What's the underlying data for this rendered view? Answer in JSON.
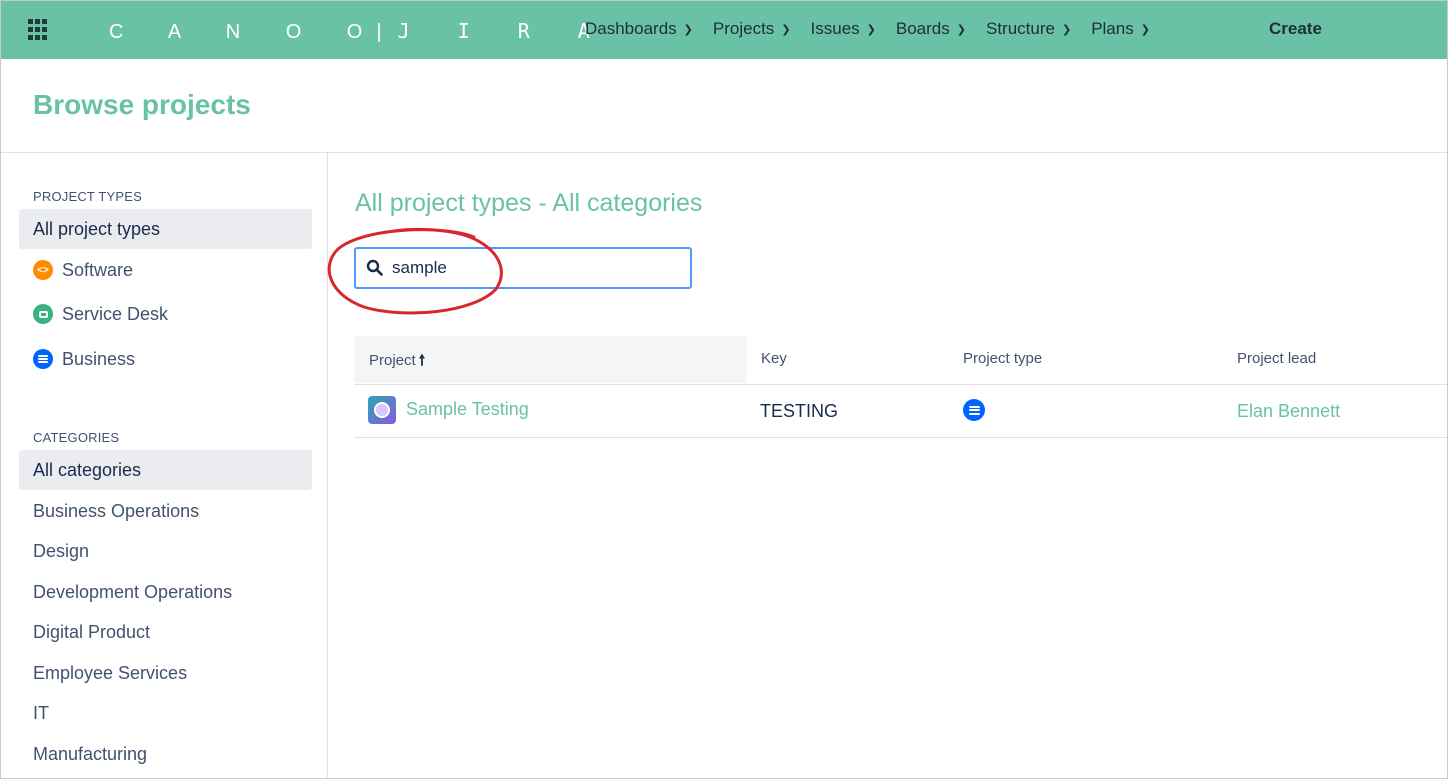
{
  "topnav": {
    "logo_left": "C A N O O",
    "logo_sep": "|",
    "logo_right": "J I R A",
    "menu": [
      {
        "label": "Dashboards"
      },
      {
        "label": "Projects"
      },
      {
        "label": "Issues"
      },
      {
        "label": "Boards"
      },
      {
        "label": "Structure"
      },
      {
        "label": "Plans"
      }
    ],
    "create_label": "Create"
  },
  "header": {
    "title": "Browse projects"
  },
  "sidebar": {
    "project_types_heading": "PROJECT TYPES",
    "project_types": [
      {
        "label": "All project types",
        "selected": true
      },
      {
        "label": "Software",
        "icon": "software-icon"
      },
      {
        "label": "Service Desk",
        "icon": "service-desk-icon"
      },
      {
        "label": "Business",
        "icon": "business-icon"
      }
    ],
    "categories_heading": "CATEGORIES",
    "categories": [
      {
        "label": "All categories",
        "selected": true
      },
      {
        "label": "Business Operations"
      },
      {
        "label": "Design"
      },
      {
        "label": "Development Operations"
      },
      {
        "label": "Digital Product"
      },
      {
        "label": "Employee Services"
      },
      {
        "label": "IT"
      },
      {
        "label": "Manufacturing"
      }
    ]
  },
  "main": {
    "title": "All project types - All categories",
    "search": {
      "value": "sample"
    },
    "table": {
      "headers": {
        "project": "Project",
        "sort_arrow": "🠕",
        "key": "Key",
        "type": "Project type",
        "lead": "Project lead"
      },
      "rows": [
        {
          "project": "Sample Testing",
          "key": "TESTING",
          "type_icon": "business-icon",
          "lead": "Elan Bennett"
        }
      ]
    }
  },
  "colors": {
    "brand": "#69c2a6",
    "annotation": "#d9262c",
    "focus": "#4c9aff"
  }
}
